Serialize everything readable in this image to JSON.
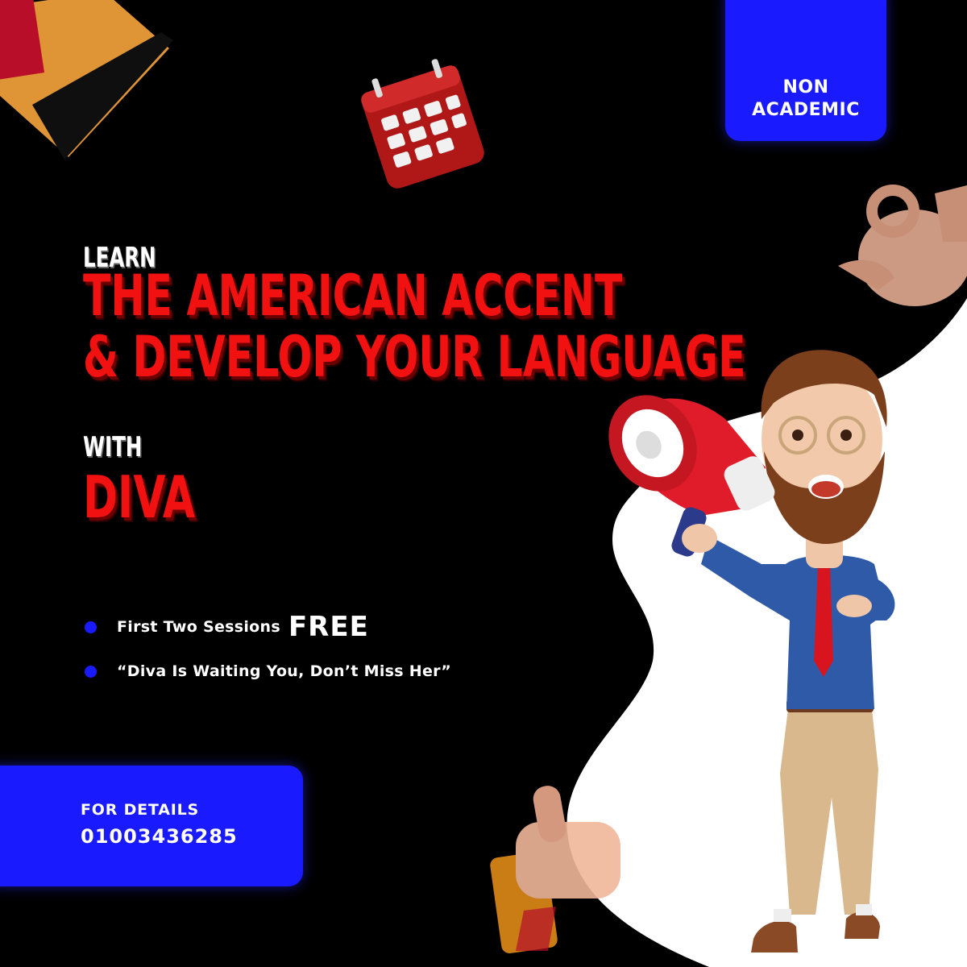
{
  "badge_top": {
    "line1": "NON",
    "line2": "ACADEMIC"
  },
  "headline": {
    "learn": "LEARN",
    "line1": "THE AMERICAN ACCENT",
    "line2": "& DEVELOP YOUR LANGUAGE",
    "with": "WITH",
    "name": "DIVA"
  },
  "bullets": [
    {
      "text": "First Two Sessions",
      "emphasis": "FREE"
    },
    {
      "text": "“Diva Is Waiting You, Don’t Miss Her”"
    }
  ],
  "contact": {
    "label": "FOR DETAILS",
    "phone": "01003436285"
  },
  "colors": {
    "background": "#000000",
    "accent_blue": "#1a1aff",
    "headline_red": "#f21111",
    "shape_white": "#ffffff"
  },
  "illustration": {
    "character": "bearded man holding megaphone",
    "decor": [
      "megaphone-icon",
      "calendar-icon",
      "ok-hand-icon",
      "thumbs-up-icon"
    ]
  }
}
